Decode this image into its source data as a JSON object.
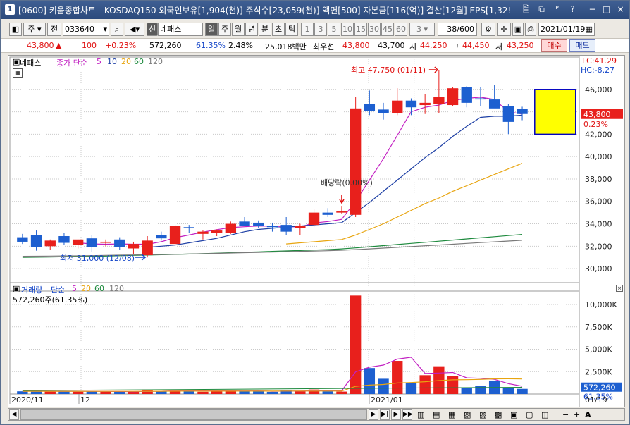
{
  "titlebar": {
    "num": "1",
    "title": "[0600] 키움종합차트 - KOSDAQ150 외국인보유[1,904(천)] 주식수[23,059(천)] 액면[500] 자본금[116(억)] 결산[12월] EPS[1,32!",
    "buttons": [
      "🗎",
      "⧉",
      "ᴾ",
      "?",
      "−",
      "□",
      "×"
    ]
  },
  "toolbar": {
    "type_label": "주",
    "prev_label": "전",
    "code": "033640",
    "badge": "신",
    "stock_name": "네패스",
    "periods": [
      "일",
      "주",
      "월",
      "년",
      "분",
      "초",
      "틱"
    ],
    "numbers": [
      "1",
      "3",
      "5",
      "10",
      "15",
      "30",
      "45",
      "60"
    ],
    "num_select": "3",
    "count": "38/600",
    "date": "2021/01/19"
  },
  "pricebar": {
    "price": "43,800",
    "arrow": "▲",
    "change": "100",
    "change_pct": "+0.23%",
    "volume": "572,260",
    "vol_ratio": "61.35%",
    "turnover": "2.48%",
    "amount": "25,018백만",
    "pref_label": "최우선",
    "ask": "43,800",
    "bid": "43,700",
    "open_label": "시",
    "open": "44,250",
    "high_label": "고",
    "high": "44,450",
    "low_label": "저",
    "low": "43,250",
    "buy": "매수",
    "sell": "매도"
  },
  "chart_data": [
    {
      "type": "candlestick",
      "title": "네패스",
      "legend": {
        "prefix": "종가 단순",
        "periods": [
          "5",
          "10",
          "20",
          "60",
          "120"
        ]
      },
      "ylim": [
        29000,
        48000
      ],
      "yticks": [
        30000,
        32000,
        34000,
        36000,
        38000,
        40000,
        42000,
        44000,
        46000
      ],
      "ytick_labels": [
        "30,000",
        "32,000",
        "34,000",
        "36,000",
        "38,000",
        "40,000",
        "42,000",
        "44,000",
        "46,000"
      ],
      "x_labels": [
        "2020/11",
        "12",
        "2021/01"
      ],
      "right_labels": {
        "lc": "LC:41.29",
        "hc": "HC:-8.27",
        "price": "43,800",
        "pct": "0.23%"
      },
      "annotations": {
        "high": "최고 47,750 (01/11)",
        "low": "최저 31,000 (12/08)",
        "dividend": "배당락(0.00%)"
      },
      "candles": [
        {
          "o": 32800,
          "h": 33100,
          "l": 32200,
          "c": 32400
        },
        {
          "o": 33000,
          "h": 33400,
          "l": 31600,
          "c": 31900
        },
        {
          "o": 32000,
          "h": 32600,
          "l": 31700,
          "c": 32500
        },
        {
          "o": 32900,
          "h": 33200,
          "l": 32100,
          "c": 32300
        },
        {
          "o": 32100,
          "h": 32600,
          "l": 31800,
          "c": 32600
        },
        {
          "o": 32700,
          "h": 33000,
          "l": 31500,
          "c": 31900
        },
        {
          "o": 32300,
          "h": 32600,
          "l": 32000,
          "c": 32400
        },
        {
          "o": 32600,
          "h": 32800,
          "l": 31700,
          "c": 31900
        },
        {
          "o": 31800,
          "h": 32400,
          "l": 31300,
          "c": 32200
        },
        {
          "o": 31200,
          "h": 32900,
          "l": 31000,
          "c": 32500
        },
        {
          "o": 33000,
          "h": 33300,
          "l": 32500,
          "c": 32700
        },
        {
          "o": 32200,
          "h": 33900,
          "l": 32100,
          "c": 33800
        },
        {
          "o": 33700,
          "h": 33900,
          "l": 33200,
          "c": 33600
        },
        {
          "o": 33100,
          "h": 33400,
          "l": 32600,
          "c": 33300
        },
        {
          "o": 33200,
          "h": 33500,
          "l": 32900,
          "c": 33400
        },
        {
          "o": 33200,
          "h": 34200,
          "l": 33100,
          "c": 34000
        },
        {
          "o": 34200,
          "h": 34600,
          "l": 33800,
          "c": 33800
        },
        {
          "o": 34100,
          "h": 34300,
          "l": 33600,
          "c": 33800
        },
        {
          "o": 33800,
          "h": 34100,
          "l": 33300,
          "c": 33700
        },
        {
          "o": 33900,
          "h": 34600,
          "l": 33000,
          "c": 33300
        },
        {
          "o": 33600,
          "h": 34000,
          "l": 33000,
          "c": 33800
        },
        {
          "o": 33900,
          "h": 35300,
          "l": 33700,
          "c": 35000
        },
        {
          "o": 35000,
          "h": 35400,
          "l": 34600,
          "c": 34800
        },
        {
          "o": 35000,
          "h": 35600,
          "l": 34900,
          "c": 35100
        },
        {
          "o": 34800,
          "h": 45300,
          "l": 34600,
          "c": 44300
        },
        {
          "o": 44700,
          "h": 45900,
          "l": 43700,
          "c": 44100
        },
        {
          "o": 44200,
          "h": 44800,
          "l": 43300,
          "c": 43900
        },
        {
          "o": 43900,
          "h": 46100,
          "l": 43700,
          "c": 45000
        },
        {
          "o": 45000,
          "h": 45200,
          "l": 43700,
          "c": 44400
        },
        {
          "o": 44600,
          "h": 45600,
          "l": 43800,
          "c": 44800
        },
        {
          "o": 44700,
          "h": 47750,
          "l": 43900,
          "c": 45300
        },
        {
          "o": 44600,
          "h": 46200,
          "l": 44500,
          "c": 46100
        },
        {
          "o": 46200,
          "h": 46300,
          "l": 44400,
          "c": 44800
        },
        {
          "o": 45200,
          "h": 46200,
          "l": 44500,
          "c": 45100
        },
        {
          "o": 45100,
          "h": 46400,
          "l": 44400,
          "c": 44300
        },
        {
          "o": 44500,
          "h": 44700,
          "l": 42000,
          "c": 43100
        },
        {
          "o": 44250,
          "h": 44450,
          "l": 43250,
          "c": 43800
        }
      ],
      "ma_series": [
        {
          "name": "5",
          "color": "#c21fc2",
          "values": [
            null,
            null,
            null,
            null,
            32300,
            32200,
            32180,
            32200,
            32180,
            32180,
            32400,
            32760,
            33000,
            33260,
            33480,
            33660,
            33740,
            33800,
            33780,
            33750,
            33720,
            34080,
            34200,
            34400,
            36000,
            37900,
            39800,
            41900,
            44000,
            44400,
            44600,
            45000,
            45200,
            45300,
            45100,
            44000,
            43800
          ]
        },
        {
          "name": "10",
          "color": "#1d3fa5",
          "values": [
            null,
            null,
            null,
            null,
            null,
            null,
            null,
            null,
            null,
            31900,
            32000,
            32100,
            32300,
            32500,
            32700,
            33000,
            33300,
            33500,
            33600,
            33700,
            33800,
            33900,
            34000,
            34100,
            35000,
            35900,
            36900,
            37900,
            38900,
            39900,
            40800,
            41800,
            42700,
            43500,
            43600,
            43600,
            43700
          ]
        },
        {
          "name": "20",
          "color": "#e8a510",
          "values": [
            null,
            null,
            null,
            null,
            null,
            null,
            null,
            null,
            null,
            null,
            null,
            null,
            null,
            null,
            null,
            null,
            null,
            null,
            null,
            32200,
            32300,
            32400,
            32500,
            32600,
            33000,
            33500,
            34000,
            34600,
            35200,
            35800,
            36300,
            36900,
            37400,
            37900,
            38400,
            38900,
            39400,
            40000,
            40200
          ]
        },
        {
          "name": "60",
          "color": "#1e8a3e",
          "values": [
            31000,
            31020,
            31040,
            31060,
            31080,
            31100,
            31120,
            31150,
            31180,
            31210,
            31240,
            31270,
            31300,
            31340,
            31380,
            31420,
            31460,
            31500,
            31540,
            31580,
            31620,
            31660,
            31700,
            31760,
            31850,
            31950,
            32050,
            32150,
            32250,
            32350,
            32450,
            32550,
            32650,
            32750,
            32850,
            32950,
            33050,
            33150,
            33300
          ]
        },
        {
          "name": "120",
          "color": "#7a7a7a",
          "values": [
            31100,
            31110,
            31120,
            31130,
            31140,
            31160,
            31180,
            31200,
            31220,
            31240,
            31260,
            31280,
            31300,
            31330,
            31360,
            31390,
            31420,
            31450,
            31480,
            31510,
            31540,
            31570,
            31600,
            31640,
            31700,
            31760,
            31830,
            31900,
            31970,
            32040,
            32110,
            32180,
            32250,
            32320,
            32390,
            32460,
            32530,
            32600,
            32700
          ]
        }
      ]
    },
    {
      "type": "bar",
      "title": "거래량",
      "legend": {
        "prefix": "단순",
        "periods": [
          "5",
          "20",
          "60",
          "120"
        ]
      },
      "summary": "572,260주(61.35%)",
      "ylim": [
        0,
        11500000
      ],
      "yticks": [
        2500000,
        5000000,
        7500000,
        10000000
      ],
      "ytick_labels": [
        "2,500K",
        "5,000K",
        "7,500K",
        "10,000K"
      ],
      "right_labels": {
        "value": "572,260",
        "pct": "61.35%"
      },
      "bottom_right": "01/19",
      "values": [
        300000,
        350000,
        280000,
        320000,
        260000,
        300000,
        260000,
        240000,
        280000,
        500000,
        300000,
        500000,
        300000,
        250000,
        300000,
        420000,
        280000,
        300000,
        240000,
        450000,
        300000,
        500000,
        300000,
        270000,
        11000000,
        2900000,
        1700000,
        3700000,
        1200000,
        2100000,
        3100000,
        2000000,
        700000,
        900000,
        1500000,
        700000,
        572260
      ],
      "ma5": [
        300000,
        320000,
        310000,
        310000,
        300000,
        300000,
        290000,
        280000,
        270000,
        310000,
        310000,
        360000,
        370000,
        370000,
        380000,
        350000,
        340000,
        350000,
        310000,
        330000,
        320000,
        360000,
        360000,
        360000,
        2470000,
        3000000,
        3230000,
        3900000,
        4100000,
        2300000,
        2340000,
        2400000,
        1800000,
        1760000,
        1640000,
        1160000,
        870000
      ],
      "ma20": [
        300000,
        300000,
        300000,
        300000,
        300000,
        300000,
        300000,
        300000,
        300000,
        310000,
        310000,
        320000,
        320000,
        320000,
        320000,
        320000,
        320000,
        320000,
        320000,
        330000,
        330000,
        330000,
        330000,
        330000,
        860000,
        990000,
        1060000,
        1230000,
        1280000,
        1370000,
        1500000,
        1580000,
        1600000,
        1630000,
        1690000,
        1700000,
        1680000
      ]
    }
  ]
}
